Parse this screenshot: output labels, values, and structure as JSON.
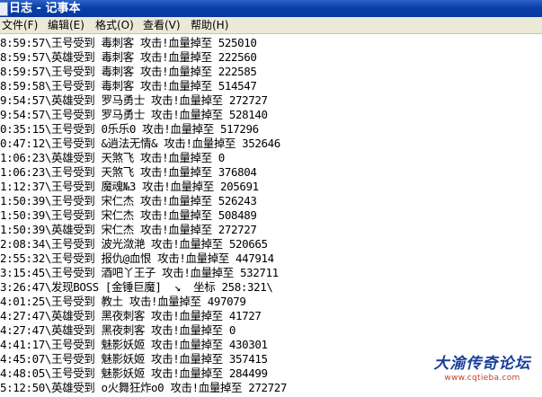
{
  "window": {
    "title": "日志 - 记事本"
  },
  "menu": [
    {
      "label": "文件(F)"
    },
    {
      "label": "编辑(E)"
    },
    {
      "label": "格式(O)"
    },
    {
      "label": "查看(V)"
    },
    {
      "label": "帮助(H)"
    }
  ],
  "log_lines": [
    "8:59:57\\王号受到 毒刺客 攻击!血量掉至 525010",
    "8:59:57\\英雄受到 毒刺客 攻击!血量掉至 222560",
    "8:59:57\\王号受到 毒刺客 攻击!血量掉至 222585",
    "8:59:58\\王号受到 毒刺客 攻击!血量掉至 514547",
    "9:54:57\\英雄受到 罗马勇士 攻击!血量掉至 272727",
    "9:54:57\\王号受到 罗马勇士 攻击!血量掉至 528140",
    "0:35:15\\王号受到 0乐乐0 攻击!血量掉至 517296",
    "0:47:12\\王号受到 &逍法无情& 攻击!血量掉至 352646",
    "1:06:23\\英雄受到 天煞飞 攻击!血量掉至 0",
    "1:06:23\\王号受到 天煞飞 攻击!血量掉至 376804",
    "1:12:37\\王号受到 魔魂№3 攻击!血量掉至 205691",
    "1:50:39\\王号受到 宋仁杰 攻击!血量掉至 526243",
    "1:50:39\\王号受到 宋仁杰 攻击!血量掉至 508489",
    "1:50:39\\英雄受到 宋仁杰 攻击!血量掉至 272727",
    "2:08:34\\王号受到 波光潋滟 攻击!血量掉至 520665",
    "2:55:32\\王号受到 报仇@血恨 攻击!血量掉至 447914",
    "3:15:45\\王号受到 酒吧丫王子 攻击!血量掉至 532711",
    "3:26:47\\发现BOSS [金锤巨魔]  ↘  坐标 258:321\\",
    "4:01:25\\王号受到 教土 攻击!血量掉至 497079",
    "4:27:47\\英雄受到 黑夜刺客 攻击!血量掉至 41727",
    "4:27:47\\英雄受到 黑夜刺客 攻击!血量掉至 0",
    "4:41:17\\王号受到 魅影妖姬 攻击!血量掉至 430301",
    "4:45:07\\王号受到 魅影妖姬 攻击!血量掉至 357415",
    "4:48:05\\王号受到 魅影妖姬 攻击!血量掉至 284499",
    "5:12:50\\英雄受到 o火舞狂炸o0 攻击!血量掉至 272727"
  ],
  "watermark": {
    "title": "大渝传奇论坛",
    "url": "www.cqtieba.com"
  }
}
